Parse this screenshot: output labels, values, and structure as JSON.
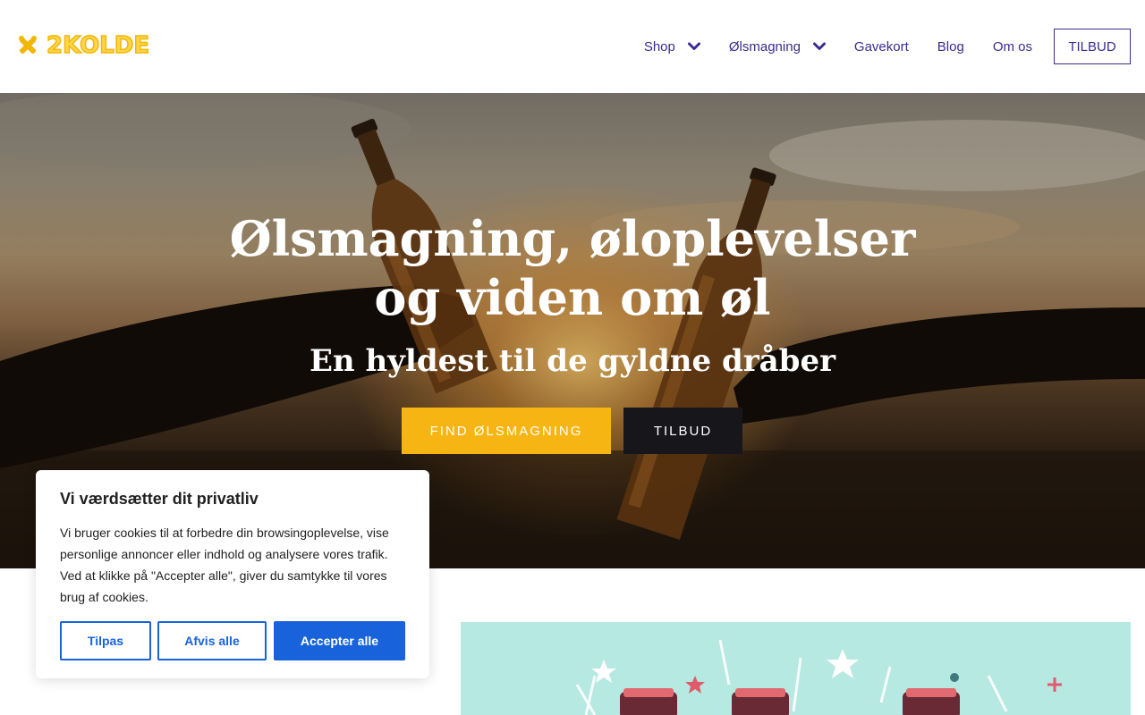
{
  "brand": {
    "logo_text": "2KOLDE",
    "color": "#f2b705"
  },
  "nav": {
    "items": [
      {
        "label": "Shop",
        "has_dropdown": true
      },
      {
        "label": "Ølsmagning",
        "has_dropdown": true
      },
      {
        "label": "Gavekort",
        "has_dropdown": false
      },
      {
        "label": "Blog",
        "has_dropdown": false
      },
      {
        "label": "Om os",
        "has_dropdown": false
      }
    ],
    "cta_label": "TILBUD",
    "color": "#3b2d8f"
  },
  "hero": {
    "title": "Ølsmagning, øloplevelser og viden om øl",
    "subtitle": "En hyldest til de gyldne dråber",
    "primary_button": "FIND ØLSMAGNING",
    "secondary_button": "TILBUD",
    "primary_color": "#f6b512",
    "secondary_color": "#17161a"
  },
  "cookie_banner": {
    "title": "Vi værdsætter dit privatliv",
    "text": "Vi bruger cookies til at forbedre din browsingoplevelse, vise personlige annoncer eller indhold og analysere vores trafik. Ved at klikke på \"Accepter alle\", giver du samtykke til vores brug af cookies.",
    "customize_label": "Tilpas",
    "reject_label": "Afvis alle",
    "accept_label": "Accepter alle",
    "accent_color": "#1863dc"
  }
}
